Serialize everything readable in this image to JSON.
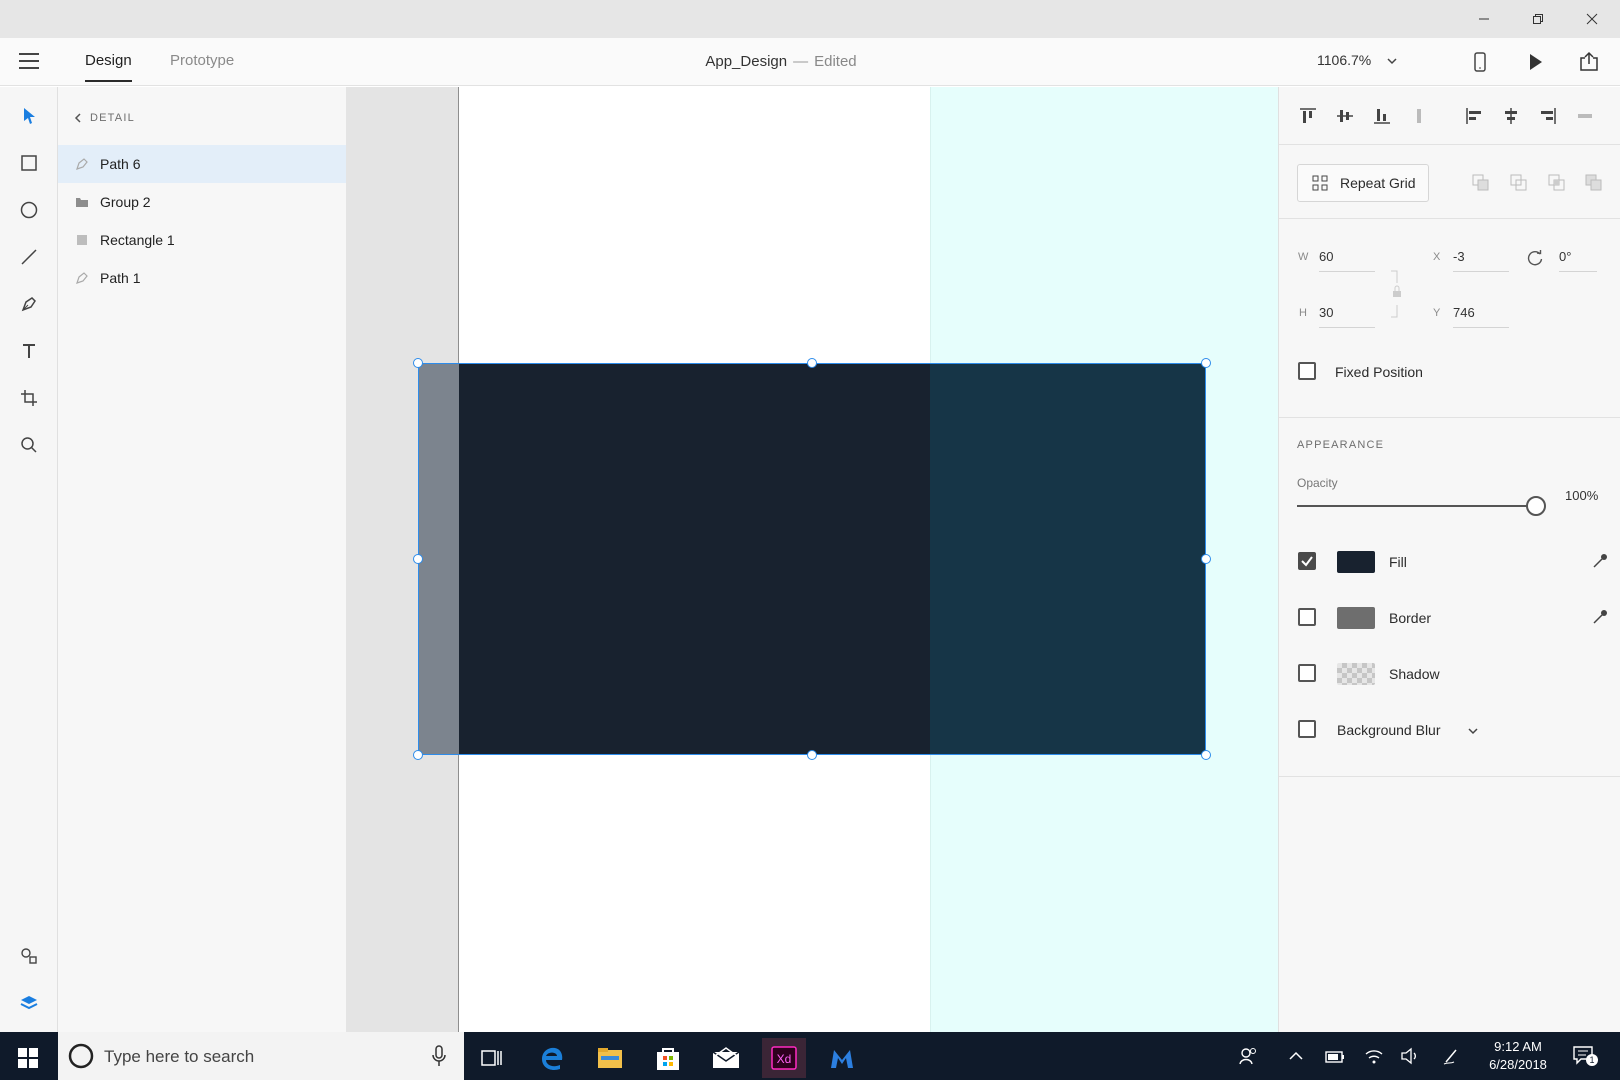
{
  "header": {
    "tabs": [
      {
        "label": "Design"
      },
      {
        "label": "Prototype"
      }
    ],
    "doc_name": "App_Design",
    "doc_sep": "—",
    "doc_status": "Edited",
    "zoom": "1106.7%"
  },
  "layers": {
    "back_label": "DETAIL",
    "items": [
      {
        "label": "Path 6",
        "icon": "pen-path-icon",
        "selected": true
      },
      {
        "label": "Group 2",
        "icon": "folder-icon"
      },
      {
        "label": "Rectangle 1",
        "icon": "rectangle-icon"
      },
      {
        "label": "Path 1",
        "icon": "pen-path-icon"
      }
    ]
  },
  "props": {
    "repeat_grid": "Repeat Grid",
    "w_label": "W",
    "w": "60",
    "h_label": "H",
    "h": "30",
    "x_label": "X",
    "x": "-3",
    "y_label": "Y",
    "y": "746",
    "rotation": "0°",
    "fixed_position": "Fixed Position",
    "appearance": "APPEARANCE",
    "opacity_label": "Opacity",
    "opacity": "100%",
    "fill": "Fill",
    "border": "Border",
    "shadow": "Shadow",
    "background_blur": "Background Blur"
  },
  "colors": {
    "fill": "#18222f",
    "border": "#6e6e6e",
    "selection": "#2d8ceb",
    "artboard_cyan": "#e6fefc",
    "teal_rect": "#163547",
    "gray_rect": "#7c848e"
  },
  "taskbar": {
    "search_placeholder": "Type here to search",
    "time": "9:12 AM",
    "date": "6/28/2018",
    "notifications": "1"
  }
}
